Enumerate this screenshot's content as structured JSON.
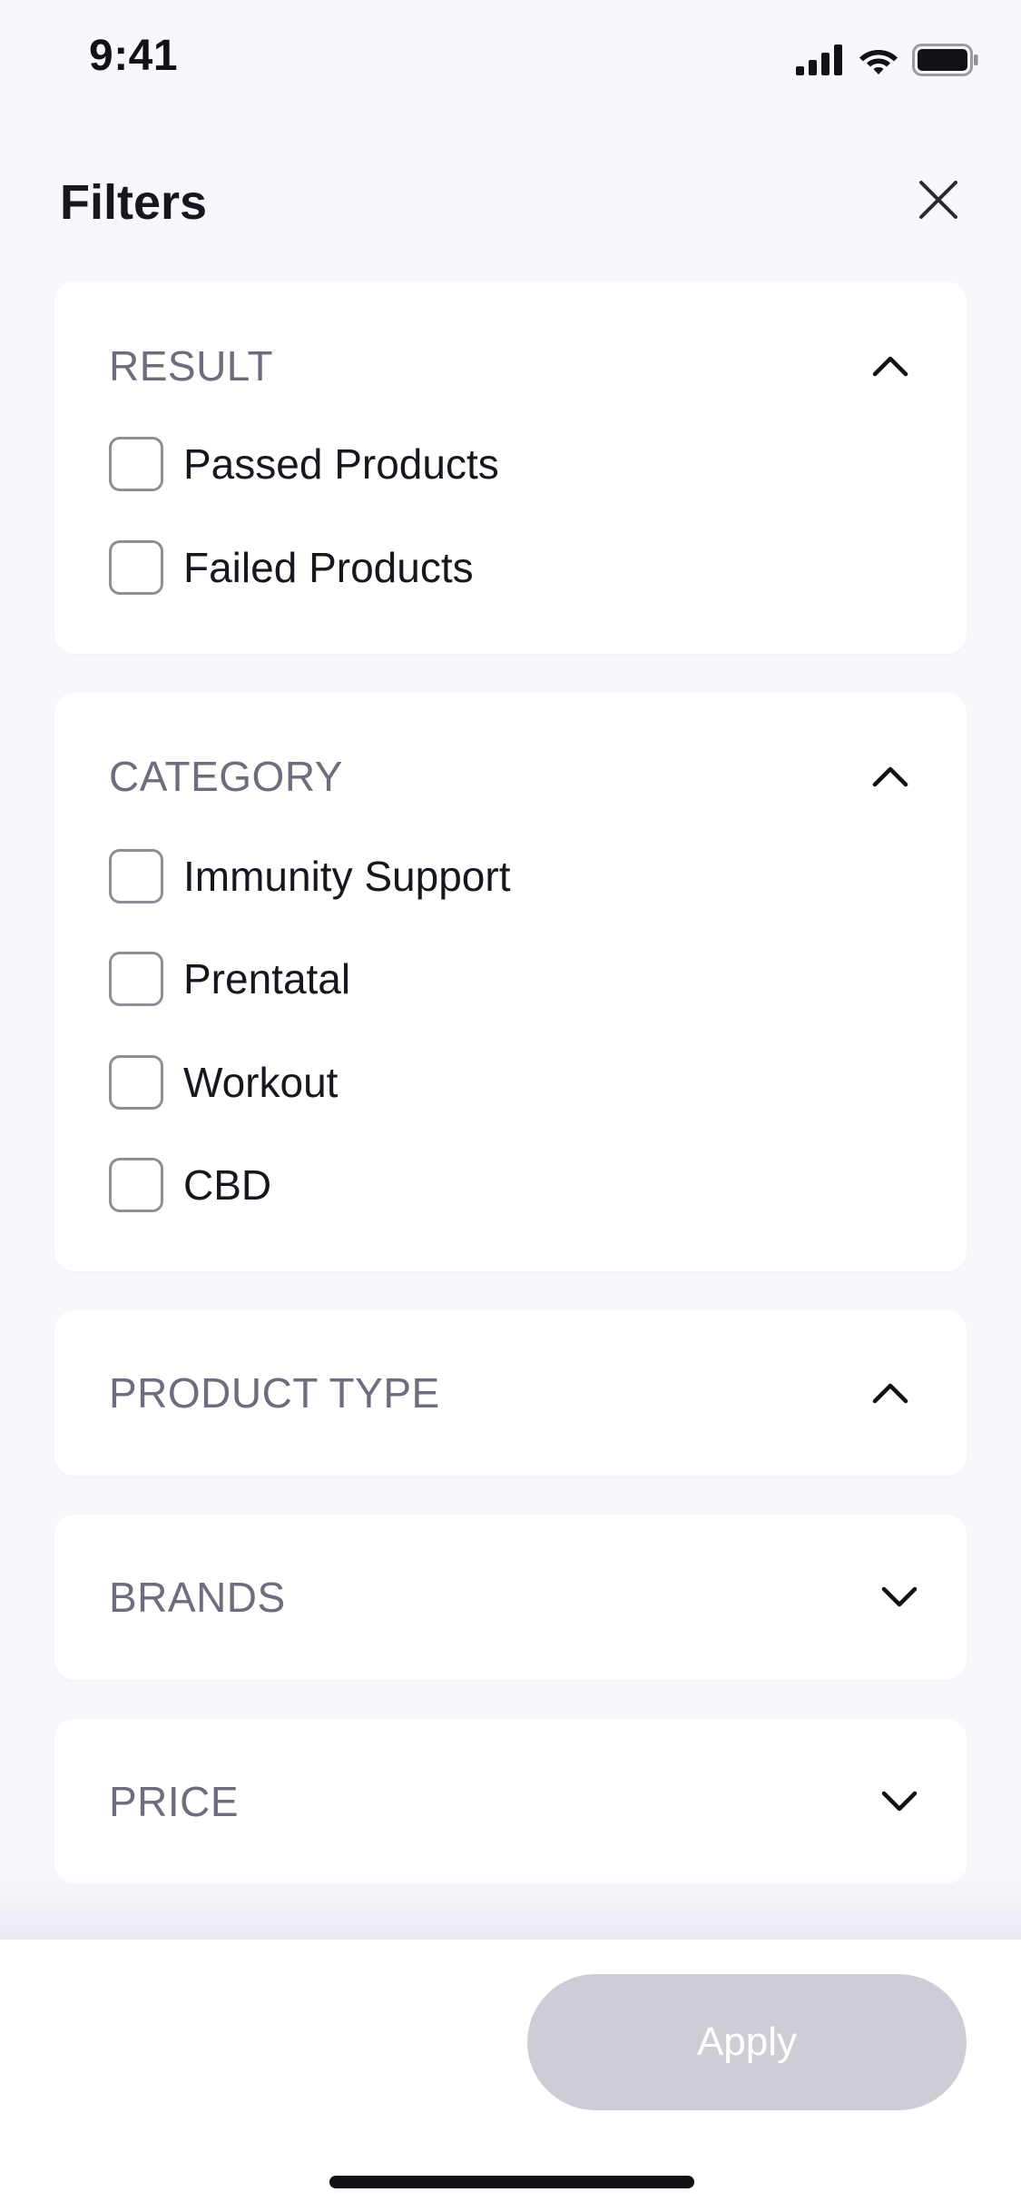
{
  "status_bar": {
    "time": "9:41",
    "icons": [
      "signal-icon",
      "wifi-icon",
      "battery-icon"
    ]
  },
  "header": {
    "title": "Filters",
    "close_icon": "close-icon"
  },
  "sections": {
    "result": {
      "title": "RESULT",
      "expanded": true,
      "options": [
        {
          "label": "Passed Products",
          "checked": false
        },
        {
          "label": "Failed Products",
          "checked": false
        }
      ]
    },
    "category": {
      "title": "CATEGORY",
      "expanded": true,
      "options": [
        {
          "label": "Immunity Support",
          "checked": false
        },
        {
          "label": "Prentatal",
          "checked": false
        },
        {
          "label": "Workout",
          "checked": false
        },
        {
          "label": "CBD",
          "checked": false
        }
      ]
    },
    "product_type": {
      "title": "PRODUCT TYPE",
      "expanded": true
    },
    "brands": {
      "title": "BRANDS",
      "expanded": false
    },
    "price": {
      "title": "PRICE",
      "expanded": false
    }
  },
  "footer": {
    "apply_label": "Apply",
    "apply_enabled": false
  },
  "colors": {
    "background": "#F8F8FC",
    "card": "#FFFFFF",
    "section_title": "#6D6D7E",
    "text": "#17171F",
    "checkbox_border": "#8E8E96",
    "apply_disabled": "#CDCDD6"
  }
}
